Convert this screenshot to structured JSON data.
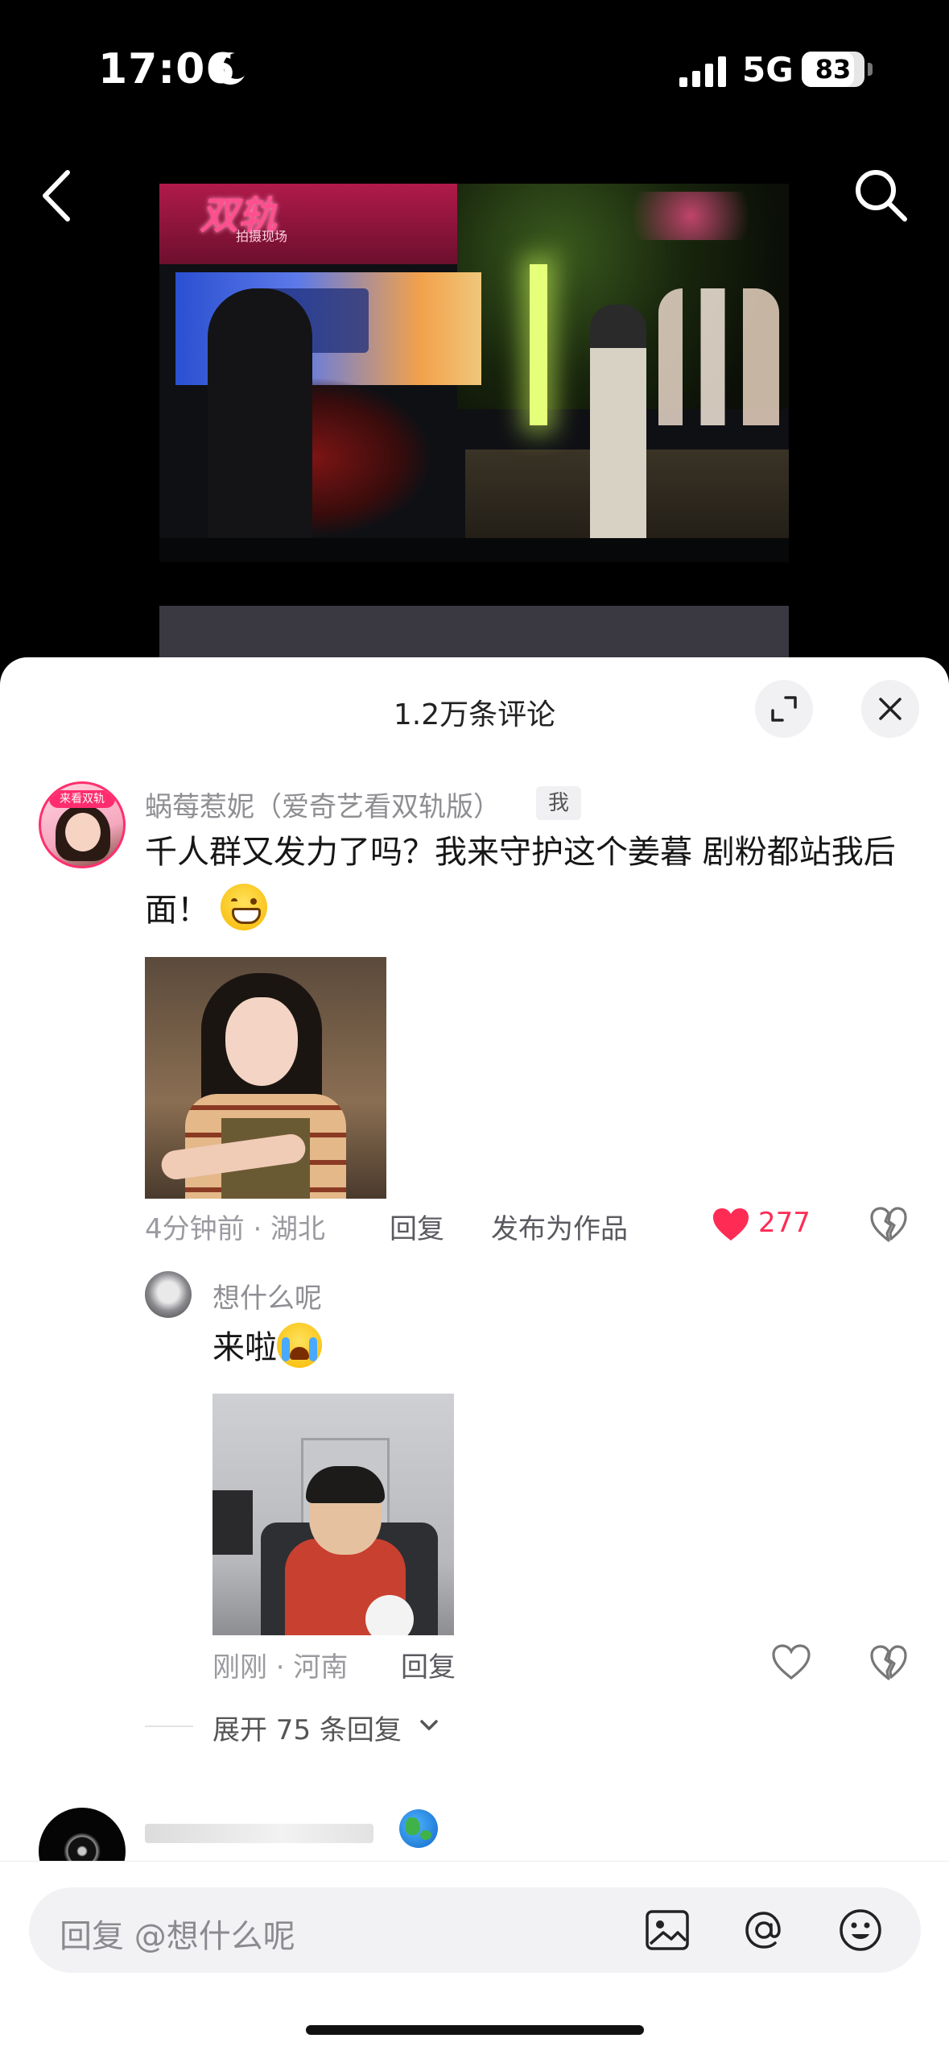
{
  "status_bar": {
    "time": "17:06",
    "network": "5G",
    "battery": "83",
    "battery_level": 0.83
  },
  "nav": {
    "back_icon": "chevron-left-icon",
    "search_icon": "search-icon"
  },
  "video": {
    "logo_text": "双轨",
    "logo_sub": "拍摄现场"
  },
  "sheet": {
    "title": "1.2万条评论",
    "expand_icon": "expand-icon",
    "close_icon": "close-icon"
  },
  "comment": {
    "username": "蜗莓惹妮（爱奇艺看双轨版）",
    "me_tag": "我",
    "avatar_badge": "来看双轨",
    "text": "千人群又发力了吗？我来守护这个姜暮 剧粉都站我后面！",
    "time_location": "4分钟前 · 湖北",
    "reply_label": "回复",
    "publish_label": "发布为作品",
    "like_count": "277",
    "liked": true
  },
  "reply": {
    "username": "想什么呢",
    "text": "来啦",
    "time_location": "刚刚 · 河南",
    "reply_label": "回复"
  },
  "expand_replies": "展开 75 条回复",
  "input": {
    "placeholder": "回复 @想什么呢",
    "icons": [
      "image-icon",
      "at-icon",
      "emoji-icon"
    ]
  },
  "colors": {
    "like_red": "#fe2c55",
    "sheet_bg": "#ffffff",
    "meta_gray": "#9a9aa0"
  }
}
